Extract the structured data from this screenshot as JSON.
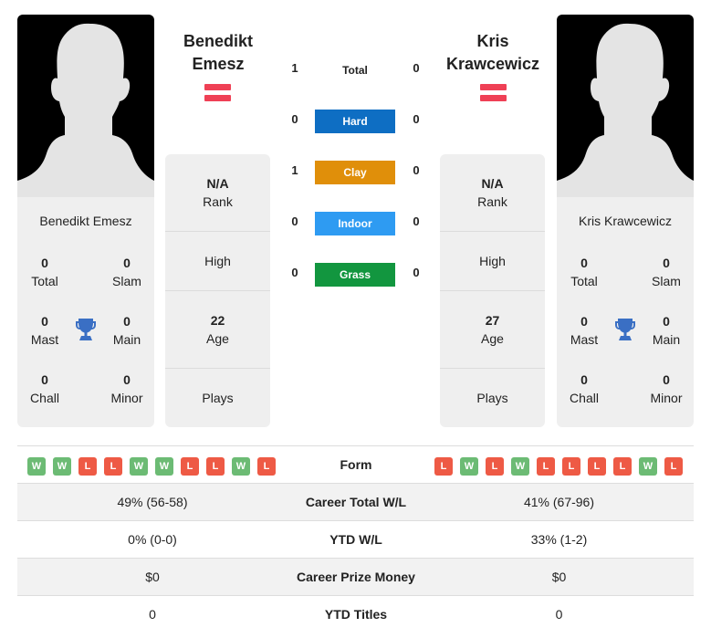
{
  "colors": {
    "win": "#6cbb74",
    "loss": "#ee5a45",
    "hard": "#0e6ec3",
    "clay": "#e08f0a",
    "indoor": "#2e9bf2",
    "grass": "#12963f",
    "flag": "#ef4055",
    "trophy": "#3a6fc4"
  },
  "player1": {
    "name": "Benedikt Emesz",
    "name_line1": "Benedikt",
    "name_line2": "Emesz",
    "flag_icon": "flag-icon",
    "card": {
      "total": {
        "value": "0",
        "label": "Total"
      },
      "slam": {
        "value": "0",
        "label": "Slam"
      },
      "mast": {
        "value": "0",
        "label": "Mast"
      },
      "main": {
        "value": "0",
        "label": "Main"
      },
      "chall": {
        "value": "0",
        "label": "Chall"
      },
      "minor": {
        "value": "0",
        "label": "Minor"
      }
    },
    "info": {
      "rank": {
        "value": "N/A",
        "label": "Rank"
      },
      "high": {
        "value": "",
        "label": "High"
      },
      "age": {
        "value": "22",
        "label": "Age"
      },
      "plays": {
        "value": "",
        "label": "Plays"
      }
    },
    "form": [
      "W",
      "W",
      "L",
      "L",
      "W",
      "W",
      "L",
      "L",
      "W",
      "L"
    ]
  },
  "player2": {
    "name": "Kris Krawcewicz",
    "name_line1": "Kris",
    "name_line2": "Krawcewicz",
    "flag_icon": "flag-icon",
    "card": {
      "total": {
        "value": "0",
        "label": "Total"
      },
      "slam": {
        "value": "0",
        "label": "Slam"
      },
      "mast": {
        "value": "0",
        "label": "Mast"
      },
      "main": {
        "value": "0",
        "label": "Main"
      },
      "chall": {
        "value": "0",
        "label": "Chall"
      },
      "minor": {
        "value": "0",
        "label": "Minor"
      }
    },
    "info": {
      "rank": {
        "value": "N/A",
        "label": "Rank"
      },
      "high": {
        "value": "",
        "label": "High"
      },
      "age": {
        "value": "27",
        "label": "Age"
      },
      "plays": {
        "value": "",
        "label": "Plays"
      }
    },
    "form": [
      "L",
      "W",
      "L",
      "W",
      "L",
      "L",
      "L",
      "L",
      "W",
      "L"
    ]
  },
  "h2h": {
    "total": {
      "label": "Total",
      "p1": "1",
      "p2": "0"
    },
    "surfaces": [
      {
        "label": "Hard",
        "p1": "0",
        "p2": "0",
        "color_key": "hard"
      },
      {
        "label": "Clay",
        "p1": "1",
        "p2": "0",
        "color_key": "clay"
      },
      {
        "label": "Indoor",
        "p1": "0",
        "p2": "0",
        "color_key": "indoor"
      },
      {
        "label": "Grass",
        "p1": "0",
        "p2": "0",
        "color_key": "grass"
      }
    ]
  },
  "table": {
    "form_label": "Form",
    "rows": [
      {
        "label": "Career Total W/L",
        "p1": "49% (56-58)",
        "p2": "41% (67-96)"
      },
      {
        "label": "YTD W/L",
        "p1": "0% (0-0)",
        "p2": "33% (1-2)"
      },
      {
        "label": "Career Prize Money",
        "p1": "$0",
        "p2": "$0"
      },
      {
        "label": "YTD Titles",
        "p1": "0",
        "p2": "0"
      }
    ]
  }
}
